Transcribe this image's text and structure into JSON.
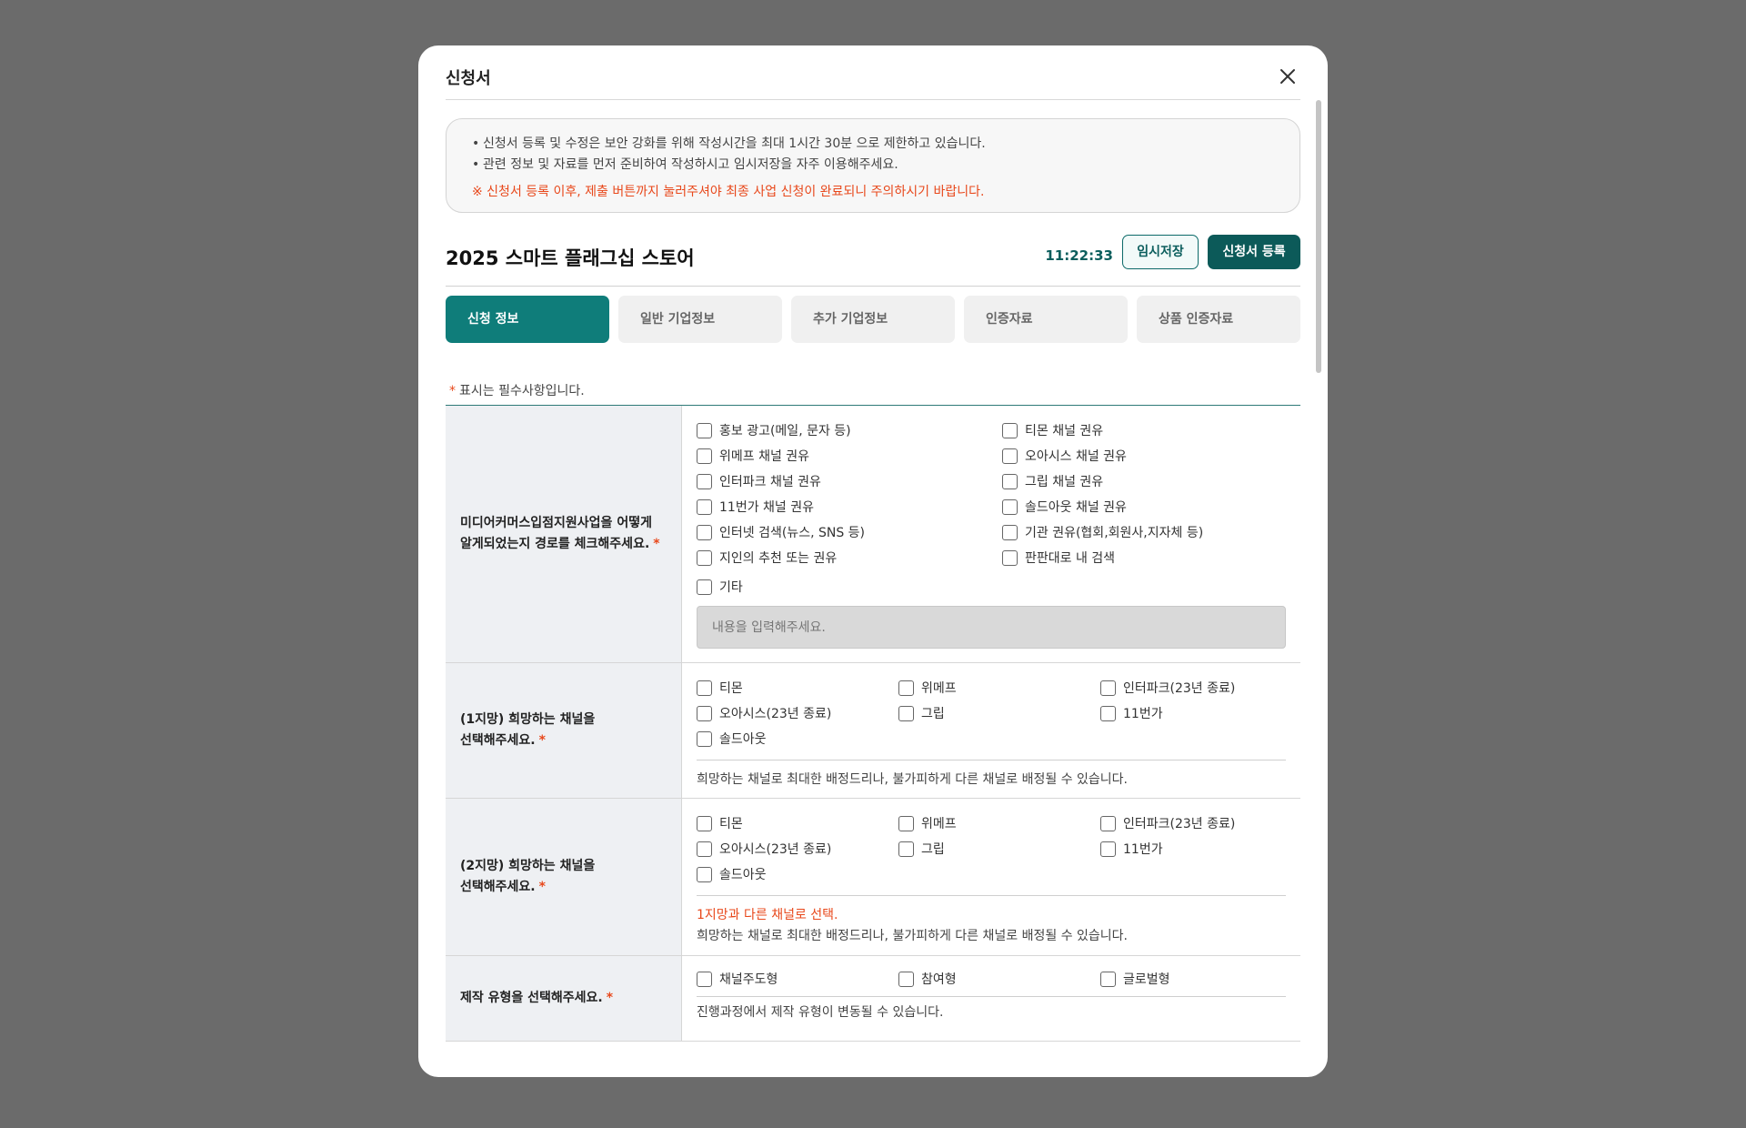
{
  "modal": {
    "title": "신청서"
  },
  "notice": {
    "lines": [
      "신청서 등록 및 수정은 보안 강화를 위해 작성시간을 최대 1시간 30분 으로 제한하고 있습니다.",
      "관련 정보 및 자료를 먼저 준비하여 작성하시고 임시저장을 자주 이용해주세요."
    ],
    "warning": "※ 신청서 등록 이후, 제출 버튼까지 눌러주셔야 최종 사업 신청이 완료되니 주의하시기 바랍니다."
  },
  "header": {
    "title": "2025 스마트 플래그십 스토어",
    "timer": "11:22:33",
    "temp_save_label": "임시저장",
    "register_label": "신청서 등록"
  },
  "tabs": [
    {
      "label": "신청 정보",
      "active": true
    },
    {
      "label": "일반 기업정보",
      "active": false
    },
    {
      "label": "추가 기업정보",
      "active": false
    },
    {
      "label": "인증자료",
      "active": false
    },
    {
      "label": "상품 인증자료",
      "active": false
    }
  ],
  "required_note": {
    "star": "*",
    "text": "표시는 필수사항입니다."
  },
  "form": {
    "q1": {
      "label_line1": "미디어커머스입점지원사업을 어떻게",
      "label_line2": "알게되었는지 경로를 체크해주세요.",
      "star": "*",
      "options": [
        "홍보 광고(메일, 문자 등)",
        "티몬 채널 권유",
        "위메프 채널 권유",
        "오아시스 채널 권유",
        "인터파크 채널 권유",
        "그립 채널 권유",
        "11번가 채널 권유",
        "솔드아웃 채널 권유",
        "인터넷 검색(뉴스, SNS 등)",
        "기관 권유(협회,회원사,지자체 등)",
        "지인의 추천 또는 권유",
        "판판대로 내 검색"
      ],
      "etc_label": "기타",
      "etc_placeholder": "내용을 입력해주세요."
    },
    "q2": {
      "label_line1": "(1지망) 희망하는 채널을",
      "label_line2": "선택해주세요.",
      "star": "*",
      "options": [
        "티몬",
        "위메프",
        "인터파크(23년 종료)",
        "오아시스(23년 종료)",
        "그립",
        "11번가",
        "솔드아웃"
      ],
      "help": "희망하는 채널로 최대한 배정드리나, 불가피하게 다른 채널로 배정될 수 있습니다."
    },
    "q3": {
      "label_line1": "(2지망) 희망하는 채널을",
      "label_line2": "선택해주세요.",
      "star": "*",
      "options": [
        "티몬",
        "위메프",
        "인터파크(23년 종료)",
        "오아시스(23년 종료)",
        "그립",
        "11번가",
        "솔드아웃"
      ],
      "warning": "1지망과 다른 채널로 선택.",
      "help": "희망하는 채널로 최대한 배정드리나, 불가피하게 다른 채널로 배정될 수 있습니다."
    },
    "q4": {
      "label": "제작 유형을 선택해주세요.",
      "star": "*",
      "options": [
        "채널주도형",
        "참여형",
        "글로벌형"
      ],
      "help": "진행과정에서 제작 유형이 변동될 수 있습니다."
    }
  },
  "colors": {
    "primary": "#0f7d7a",
    "primary_dark": "#0c5a59",
    "warning": "#e8481b",
    "overlay": "#6b6b6b"
  },
  "icons": {
    "close": "close-icon"
  }
}
